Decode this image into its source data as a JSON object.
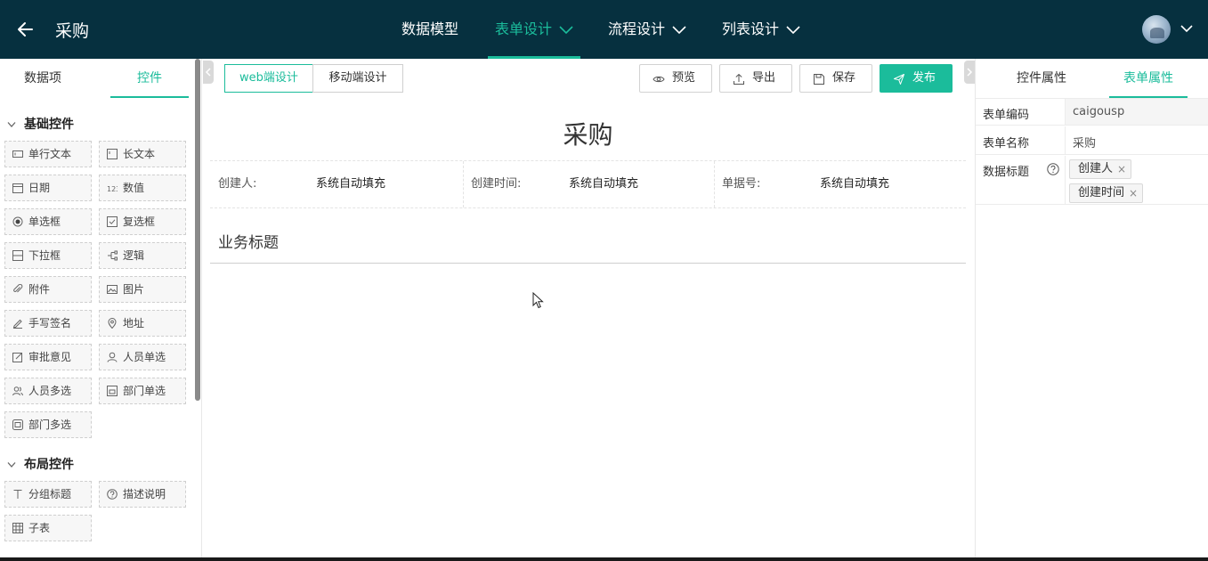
{
  "header": {
    "title": "采购",
    "nav": [
      {
        "label": "数据模型",
        "has_dropdown": false,
        "active": false
      },
      {
        "label": "表单设计",
        "has_dropdown": true,
        "active": true
      },
      {
        "label": "流程设计",
        "has_dropdown": true,
        "active": false
      },
      {
        "label": "列表设计",
        "has_dropdown": true,
        "active": false
      }
    ],
    "colors": {
      "bar": "#06303f",
      "accent": "#1bbc9b"
    }
  },
  "left_panel": {
    "tabs": [
      "数据项",
      "控件"
    ],
    "active_tab": "控件",
    "sections": [
      {
        "title": "基础控件",
        "items": [
          {
            "label": "单行文本",
            "icon": "single-line-text-icon"
          },
          {
            "label": "长文本",
            "icon": "long-text-icon"
          },
          {
            "label": "日期",
            "icon": "calendar-icon"
          },
          {
            "label": "数值",
            "icon": "number-icon"
          },
          {
            "label": "单选框",
            "icon": "radio-icon"
          },
          {
            "label": "复选框",
            "icon": "checkbox-icon"
          },
          {
            "label": "下拉框",
            "icon": "dropdown-icon"
          },
          {
            "label": "逻辑",
            "icon": "logic-icon"
          },
          {
            "label": "附件",
            "icon": "attachment-icon"
          },
          {
            "label": "图片",
            "icon": "image-icon"
          },
          {
            "label": "手写签名",
            "icon": "signature-icon"
          },
          {
            "label": "地址",
            "icon": "location-icon"
          },
          {
            "label": "审批意见",
            "icon": "approval-icon"
          },
          {
            "label": "人员单选",
            "icon": "user-icon"
          },
          {
            "label": "人员多选",
            "icon": "users-icon"
          },
          {
            "label": "部门单选",
            "icon": "department-icon"
          },
          {
            "label": "部门多选",
            "icon": "departments-icon"
          }
        ]
      },
      {
        "title": "布局控件",
        "items": [
          {
            "label": "分组标题",
            "icon": "group-title-icon"
          },
          {
            "label": "描述说明",
            "icon": "help-icon"
          },
          {
            "label": "子表",
            "icon": "subtable-icon"
          }
        ]
      }
    ]
  },
  "toolbar": {
    "mode_tabs": [
      "web端设计",
      "移动端设计"
    ],
    "active_mode": "web端设计",
    "buttons": [
      {
        "label": "预览",
        "icon": "eye-icon"
      },
      {
        "label": "导出",
        "icon": "export-icon"
      },
      {
        "label": "保存",
        "icon": "save-icon"
      },
      {
        "label": "发布",
        "icon": "send-icon"
      }
    ]
  },
  "form": {
    "title": "采购",
    "system_fields": [
      {
        "label": "创建人:",
        "value": "系统自动填充"
      },
      {
        "label": "创建时间:",
        "value": "系统自动填充"
      },
      {
        "label": "单据号:",
        "value": "系统自动填充"
      }
    ],
    "business_title": "业务标题"
  },
  "right_panel": {
    "tabs": [
      "控件属性",
      "表单属性"
    ],
    "active_tab": "表单属性",
    "props": {
      "code_label": "表单编码",
      "code_value": "caigousp",
      "name_label": "表单名称",
      "name_value": "采购",
      "data_title_label": "数据标题",
      "data_title_tags": [
        "创建人",
        "创建时间"
      ]
    }
  }
}
